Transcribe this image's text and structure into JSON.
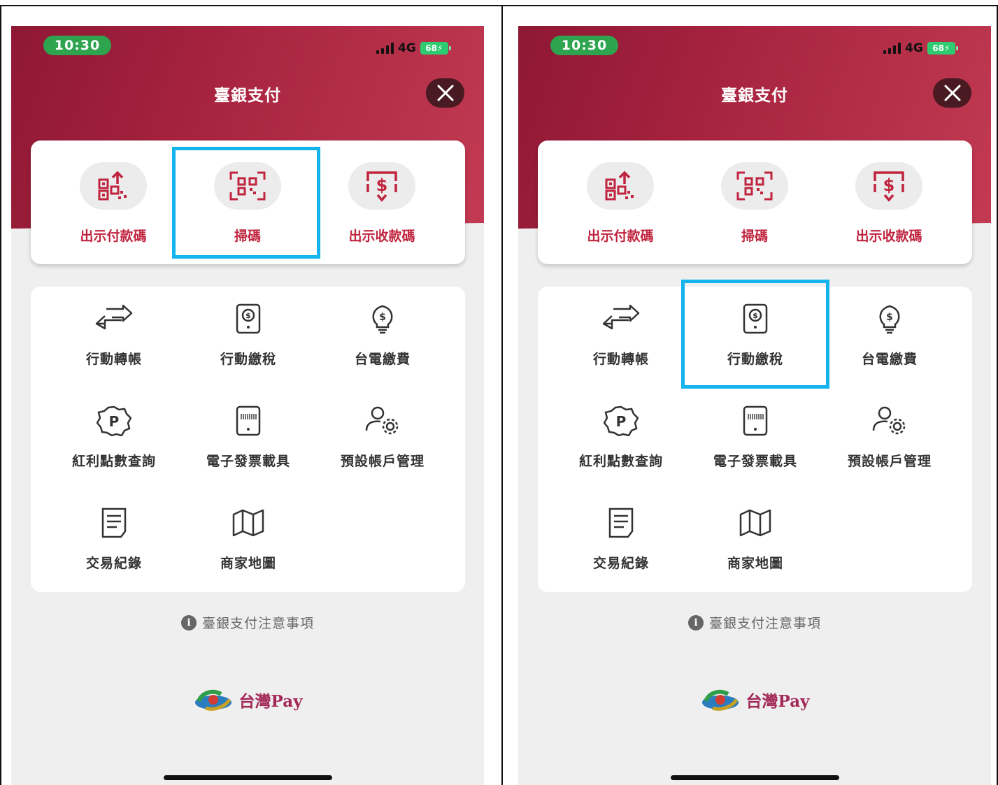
{
  "phones": [
    {
      "status": {
        "time": "10:30",
        "network": "4G",
        "battery": "68"
      },
      "title": "臺銀支付",
      "quick_actions": [
        {
          "label": "出示付款碼",
          "icon": "qr-upload-icon"
        },
        {
          "label": "掃碼",
          "icon": "qr-scan-icon"
        },
        {
          "label": "出示收款碼",
          "icon": "dollar-receive-icon"
        }
      ],
      "services": [
        {
          "label": "行動轉帳",
          "icon": "transfer-arrows-icon"
        },
        {
          "label": "行動繳稅",
          "icon": "tax-phone-icon"
        },
        {
          "label": "台電繳費",
          "icon": "lightbulb-dollar-icon"
        },
        {
          "label": "紅利點數查詢",
          "icon": "points-badge-icon"
        },
        {
          "label": "電子發票載具",
          "icon": "barcode-phone-icon"
        },
        {
          "label": "預設帳戶管理",
          "icon": "user-gear-icon"
        },
        {
          "label": "交易紀錄",
          "icon": "receipt-icon"
        },
        {
          "label": "商家地圖",
          "icon": "map-icon"
        }
      ],
      "notice": "臺銀支付注意事項",
      "brand": "台灣Pay",
      "highlighted": "掃碼"
    },
    {
      "status": {
        "time": "10:30",
        "network": "4G",
        "battery": "68"
      },
      "title": "臺銀支付",
      "quick_actions": [
        {
          "label": "出示付款碼",
          "icon": "qr-upload-icon"
        },
        {
          "label": "掃碼",
          "icon": "qr-scan-icon"
        },
        {
          "label": "出示收款碼",
          "icon": "dollar-receive-icon"
        }
      ],
      "services": [
        {
          "label": "行動轉帳",
          "icon": "transfer-arrows-icon"
        },
        {
          "label": "行動繳稅",
          "icon": "tax-phone-icon"
        },
        {
          "label": "台電繳費",
          "icon": "lightbulb-dollar-icon"
        },
        {
          "label": "紅利點數查詢",
          "icon": "points-badge-icon"
        },
        {
          "label": "電子發票載具",
          "icon": "barcode-phone-icon"
        },
        {
          "label": "預設帳戶管理",
          "icon": "user-gear-icon"
        },
        {
          "label": "交易紀錄",
          "icon": "receipt-icon"
        },
        {
          "label": "商家地圖",
          "icon": "map-icon"
        }
      ],
      "notice": "臺銀支付注意事項",
      "brand": "台灣Pay",
      "highlighted": "行動繳稅"
    }
  ],
  "colors": {
    "header_start": "#8e1834",
    "header_end": "#c33b53",
    "accent_red": "#c0253f",
    "highlight_blue": "#14b4ec",
    "time_pill": "#2ea44f"
  }
}
